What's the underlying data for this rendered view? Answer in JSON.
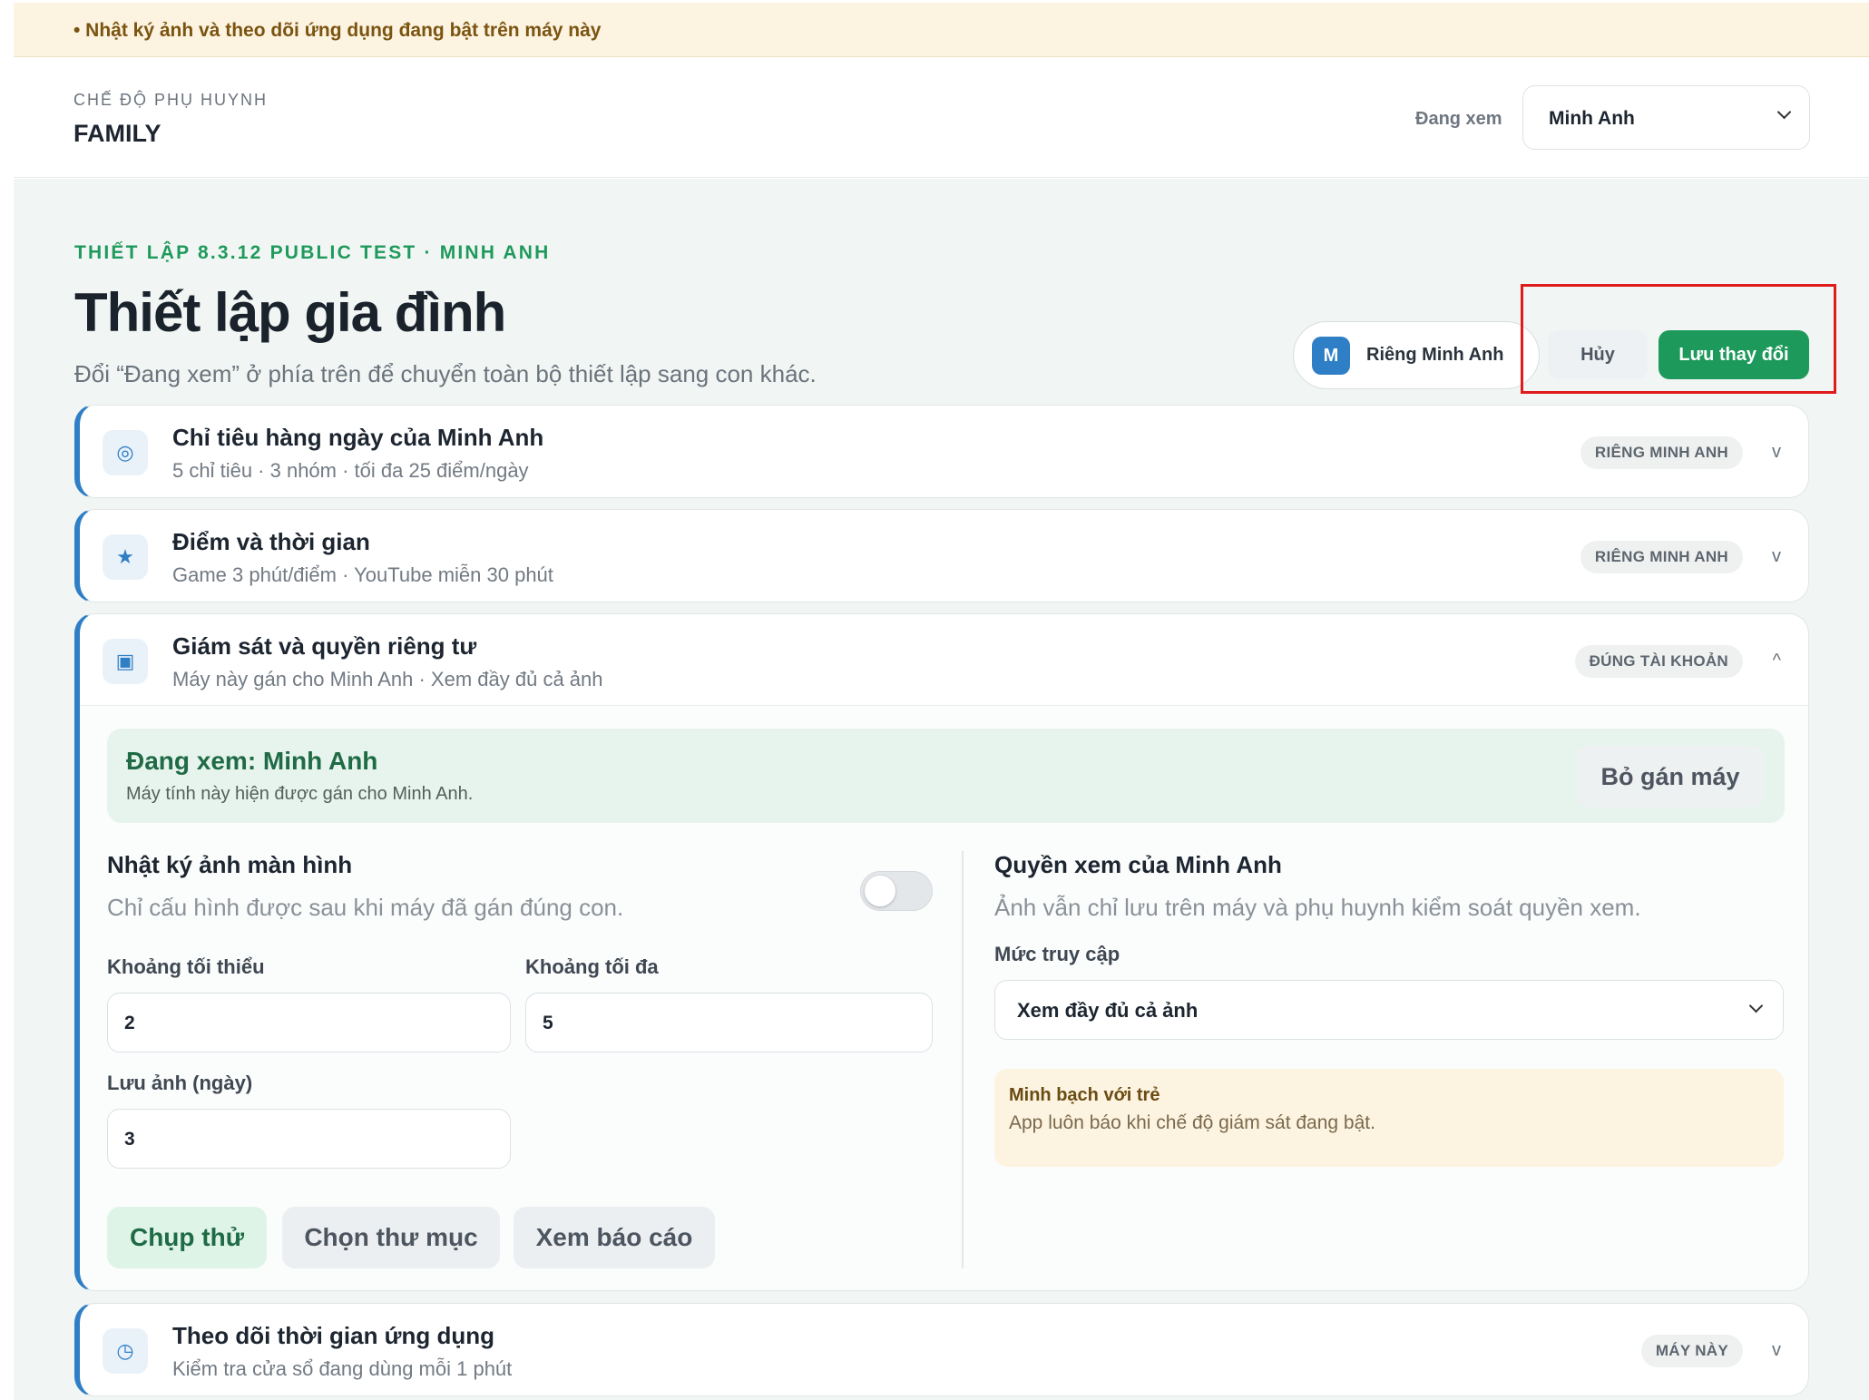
{
  "banner": {
    "text": "• Nhật ký ảnh và theo dõi ứng dụng đang bật trên máy này"
  },
  "topbar": {
    "mode_label": "CHẾ ĐỘ PHỤ HUYNH",
    "brand": "FAMILY",
    "viewing_label": "Đang xem",
    "viewing_value": "Minh Anh"
  },
  "header": {
    "eyebrow": "THIẾT LẬP 8.3.12 PUBLIC TEST · MINH ANH",
    "title": "Thiết lập gia đình",
    "subtitle": "Đổi “Đang xem” ở phía trên để chuyển toàn bộ thiết lập sang con khác.",
    "scope_avatar": "M",
    "scope_label": "Riêng Minh Anh",
    "cancel_label": "Hủy",
    "save_label": "Lưu thay đổi"
  },
  "sections": [
    {
      "icon": "target-icon",
      "glyph": "◎",
      "title": "Chỉ tiêu hàng ngày của Minh Anh",
      "subtitle": "5 chỉ tiêu · 3 nhóm · tối đa 25 điểm/ngày",
      "badge": "RIÊNG MINH ANH",
      "toggle": "v"
    },
    {
      "icon": "star-icon",
      "glyph": "★",
      "title": "Điểm và thời gian",
      "subtitle": "Game 3 phút/điểm · YouTube miễn 30 phút",
      "badge": "RIÊNG MINH ANH",
      "toggle": "v"
    },
    {
      "icon": "monitor-icon",
      "glyph": "▣",
      "title": "Giám sát và quyền riêng tư",
      "subtitle": "Máy này gán cho Minh Anh · Xem đầy đủ cả ảnh",
      "badge": "ĐÚNG TÀI KHOẢN",
      "toggle": "^"
    },
    {
      "icon": "clock-icon",
      "glyph": "◷",
      "title": "Theo dõi thời gian ứng dụng",
      "subtitle": "Kiểm tra cửa sổ đang dùng mỗi 1 phút",
      "badge": "MÁY NÀY",
      "toggle": "v"
    }
  ],
  "monitoring": {
    "assign_title": "Đang xem: Minh Anh",
    "assign_sub": "Máy tính này hiện được gán cho Minh Anh.",
    "unassign_label": "Bỏ gán máy",
    "screenshot_title": "Nhật ký ảnh màn hình",
    "screenshot_sub": "Chỉ cấu hình được sau khi máy đã gán đúng con.",
    "screenshot_enabled": false,
    "min_label": "Khoảng tối thiểu",
    "min_value": "2",
    "max_label": "Khoảng tối đa",
    "max_value": "5",
    "retention_label": "Lưu ảnh (ngày)",
    "retention_value": "3",
    "btn_test": "Chụp thử",
    "btn_folder": "Chọn thư mục",
    "btn_report": "Xem báo cáo",
    "access_title": "Quyền xem của Minh Anh",
    "access_sub": "Ảnh vẫn chỉ lưu trên máy và phụ huynh kiểm soát quyền xem.",
    "access_label": "Mức truy cập",
    "access_value": "Xem đầy đủ cả ảnh",
    "note_title": "Minh bạch với trẻ",
    "note_sub": "App luôn báo khi chế độ giám sát đang bật."
  },
  "colors": {
    "accent_green": "#1d9a5b",
    "accent_blue": "#2f7fc6",
    "highlight_red": "#e01b1b",
    "banner_bg": "#fdf3e1"
  }
}
